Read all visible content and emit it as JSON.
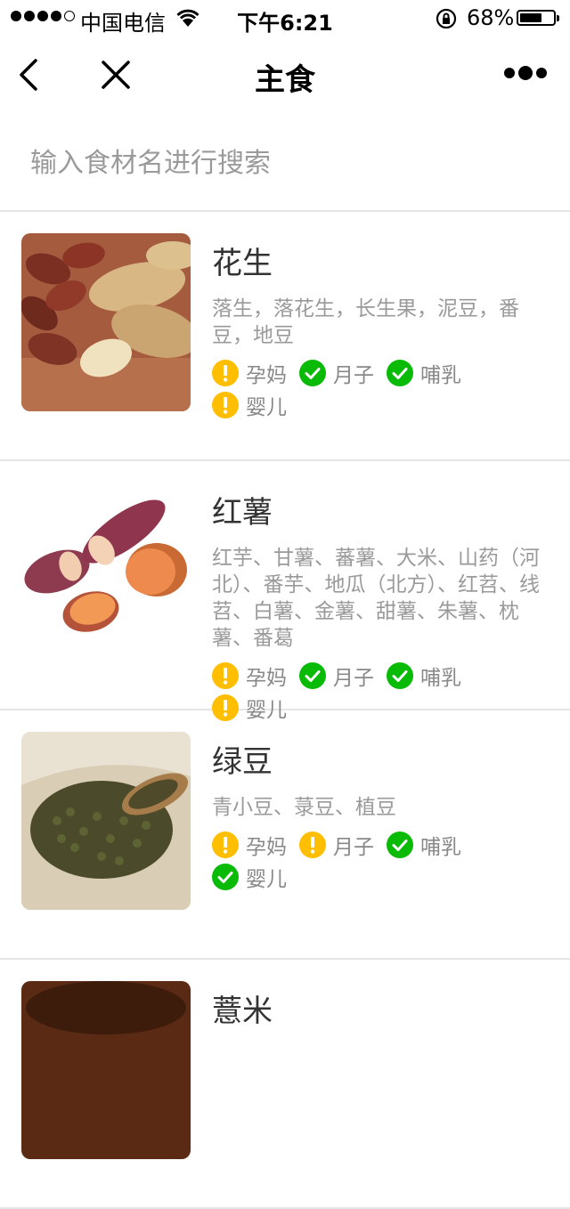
{
  "status_bar": {
    "carrier": "中国电信",
    "time": "下午6:21",
    "battery_pct": "68%",
    "battery_level": 0.68
  },
  "nav": {
    "title": "主食",
    "back_icon": "chevron-left-icon",
    "close_icon": "close-icon",
    "more_icon": "more-dots-icon"
  },
  "search": {
    "placeholder": "输入食材名进行搜索",
    "value": ""
  },
  "colors": {
    "warn": "#ffbe00",
    "ok": "#09bb07",
    "divider": "#e5e5e5"
  },
  "foods": [
    {
      "name": "花生",
      "alias": "落生，落花生，长生果，泥豆，番豆，地豆",
      "tags": [
        {
          "label": "孕妈",
          "status": "warn"
        },
        {
          "label": "月子",
          "status": "ok"
        },
        {
          "label": "哺乳",
          "status": "ok"
        },
        {
          "label": "婴儿",
          "status": "warn"
        }
      ]
    },
    {
      "name": "红薯",
      "alias": "红芋、甘薯、蕃薯、大米、山药（河北）、番芋、地瓜（北方）、红苕、线苕、白薯、金薯、甜薯、朱薯、枕薯、番葛",
      "tags": [
        {
          "label": "孕妈",
          "status": "warn"
        },
        {
          "label": "月子",
          "status": "ok"
        },
        {
          "label": "哺乳",
          "status": "ok"
        },
        {
          "label": "婴儿",
          "status": "warn"
        }
      ]
    },
    {
      "name": "绿豆",
      "alias": "青小豆、菉豆、植豆",
      "tags": [
        {
          "label": "孕妈",
          "status": "warn"
        },
        {
          "label": "月子",
          "status": "warn"
        },
        {
          "label": "哺乳",
          "status": "ok"
        },
        {
          "label": "婴儿",
          "status": "ok"
        }
      ]
    },
    {
      "name": "薏米",
      "alias": "",
      "tags": []
    }
  ]
}
